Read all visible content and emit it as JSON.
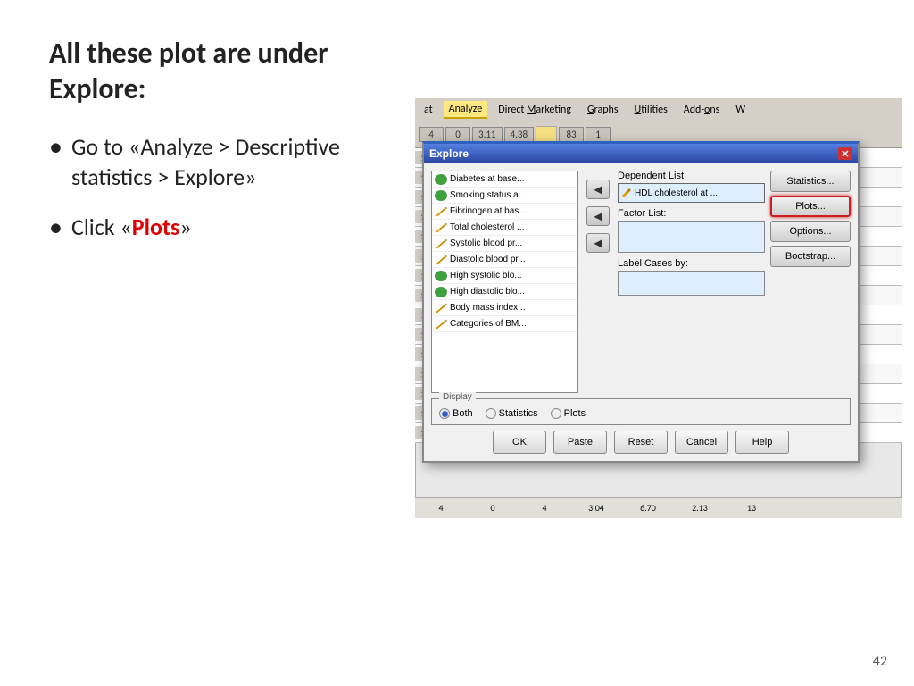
{
  "slide": {
    "title": "All these plot are under Explore:",
    "bullets": [
      {
        "text_before": "Go to «Analyze > Descriptive statistics > Explore»",
        "plain": "Go to «Analyze > Descriptive statistics > Explore»"
      },
      {
        "text_before": "Click «",
        "highlight": "Plots",
        "text_after": "»"
      }
    ],
    "page_number": "42"
  },
  "menu": {
    "items": [
      "at",
      "Analyze",
      "Direct Marketing",
      "Graphs",
      "Utilities",
      "Add-ons",
      "W"
    ]
  },
  "toolbar": {
    "cells": [
      "0",
      "1",
      "3.11",
      "4.38",
      "83",
      "1"
    ]
  },
  "dialog": {
    "title": "Explore",
    "dependent_label": "Dependent List:",
    "dependent_value": "HDL cholesterol at ...",
    "factor_label": "Factor List:",
    "label_cases_label": "Label Cases by:",
    "display_label": "Display",
    "display_options": [
      "Both",
      "Statistics",
      "Plots"
    ],
    "display_selected": "Both",
    "buttons": {
      "statistics": "Statistics...",
      "plots": "Plots...",
      "options": "Options...",
      "bootstrap": "Bootstrap..."
    },
    "bottom_buttons": [
      "OK",
      "Paste",
      "Reset",
      "Cancel",
      "Help"
    ]
  },
  "var_list": [
    "Diabetes at base...",
    "Smoking status a...",
    "Fibrinogen at bas...",
    "Total cholesterol ...",
    "Systolic blood pr...",
    "Diastolic blood pr...",
    "High systolic blo...",
    "High diastolic blo...",
    "Body mass index...",
    "Categories of BM..."
  ],
  "bottom_row": {
    "cells": [
      "4",
      "0",
      "4",
      "3.04",
      "6.70",
      "2.13",
      "13"
    ]
  }
}
